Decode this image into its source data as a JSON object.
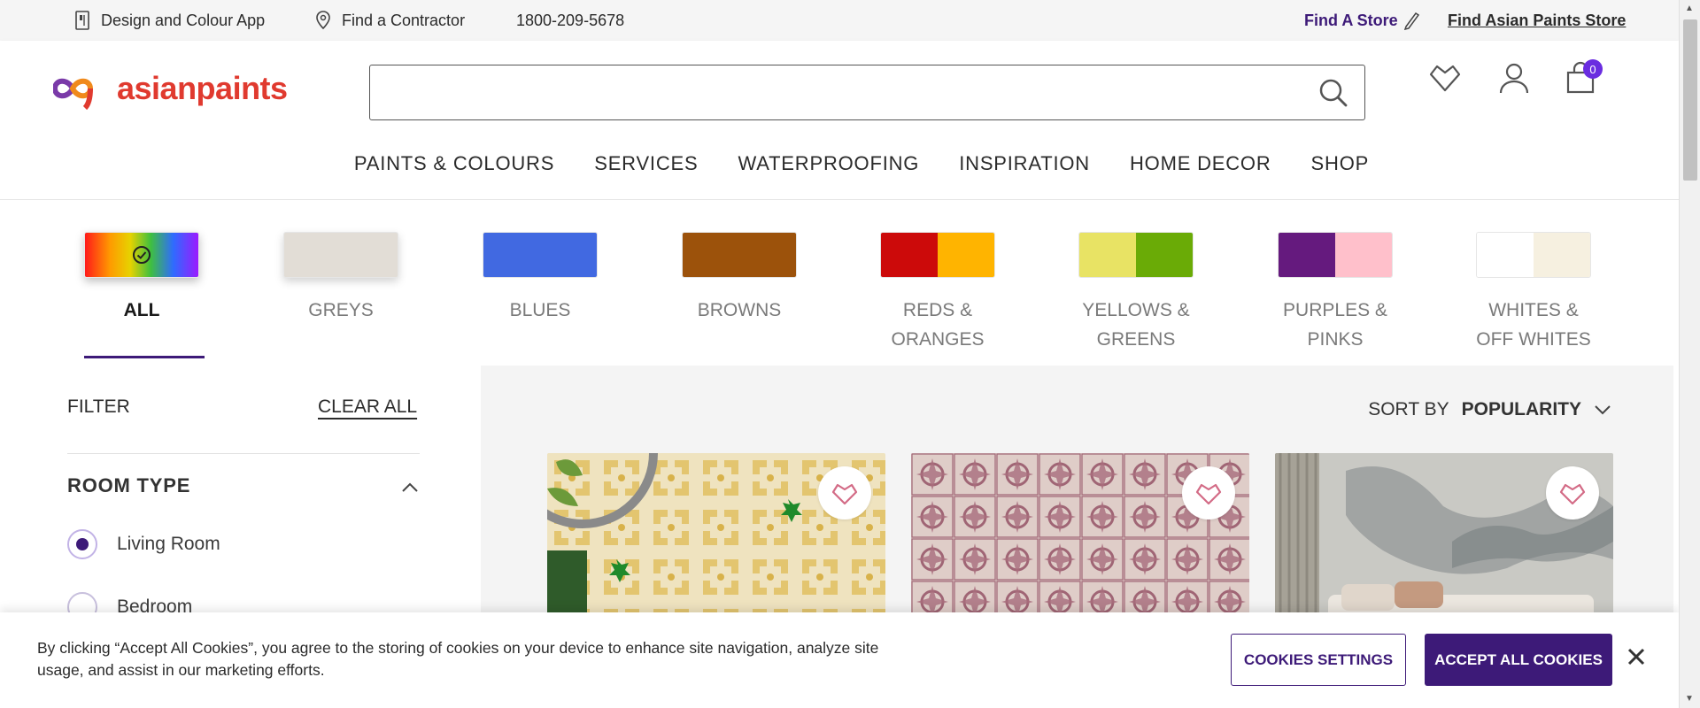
{
  "topbar": {
    "design_app": "Design and Colour App",
    "find_contractor": "Find a Contractor",
    "phone": "1800-209-5678",
    "find_store": "Find A Store",
    "find_asian_store": "Find Asian Paints Store"
  },
  "header": {
    "logo_text": "asianpaints",
    "search_placeholder": "",
    "cart_count": "0",
    "nav": [
      "PAINTS & COLOURS",
      "SERVICES",
      "WATERPROOFING",
      "INSPIRATION",
      "HOME DECOR",
      "SHOP"
    ]
  },
  "colour_families": [
    {
      "label": "ALL",
      "active": true,
      "colors": []
    },
    {
      "label": "GREYS",
      "active": false,
      "colors": [
        "#e2ddd6"
      ]
    },
    {
      "label": "BLUES",
      "active": false,
      "colors": [
        "#4169e1"
      ]
    },
    {
      "label": "BROWNS",
      "active": false,
      "colors": [
        "#9c520b"
      ]
    },
    {
      "label": "REDS & ORANGES",
      "active": false,
      "colors": [
        "#cc0a0a",
        "#ffb400"
      ]
    },
    {
      "label": "YELLOWS & GREENS",
      "active": false,
      "colors": [
        "#e8e364",
        "#6aab06"
      ]
    },
    {
      "label": "PURPLES & PINKS",
      "active": false,
      "colors": [
        "#651a7e",
        "#ffc0cb"
      ]
    },
    {
      "label": "WHITES & OFF WHITES",
      "active": false,
      "colors": [
        "#ffffff",
        "#f6f0e0"
      ]
    }
  ],
  "filter": {
    "title": "FILTER",
    "clear_all": "CLEAR ALL",
    "room_type_title": "ROOM TYPE",
    "options": [
      {
        "label": "Living Room",
        "checked": true
      },
      {
        "label": "Bedroom",
        "checked": false
      }
    ]
  },
  "sort": {
    "label": "SORT BY",
    "value": "POPULARITY"
  },
  "cookie": {
    "text": "By clicking “Accept All Cookies”, you agree to the storing of cookies on your device to enhance site navigation, analyze site usage, and assist in our marketing efforts.",
    "settings_label": "COOKIES SETTINGS",
    "accept_label": "ACCEPT ALL COOKIES"
  },
  "colors": {
    "brand_purple": "#3d1a78",
    "logo_red": "#e03a2f"
  }
}
